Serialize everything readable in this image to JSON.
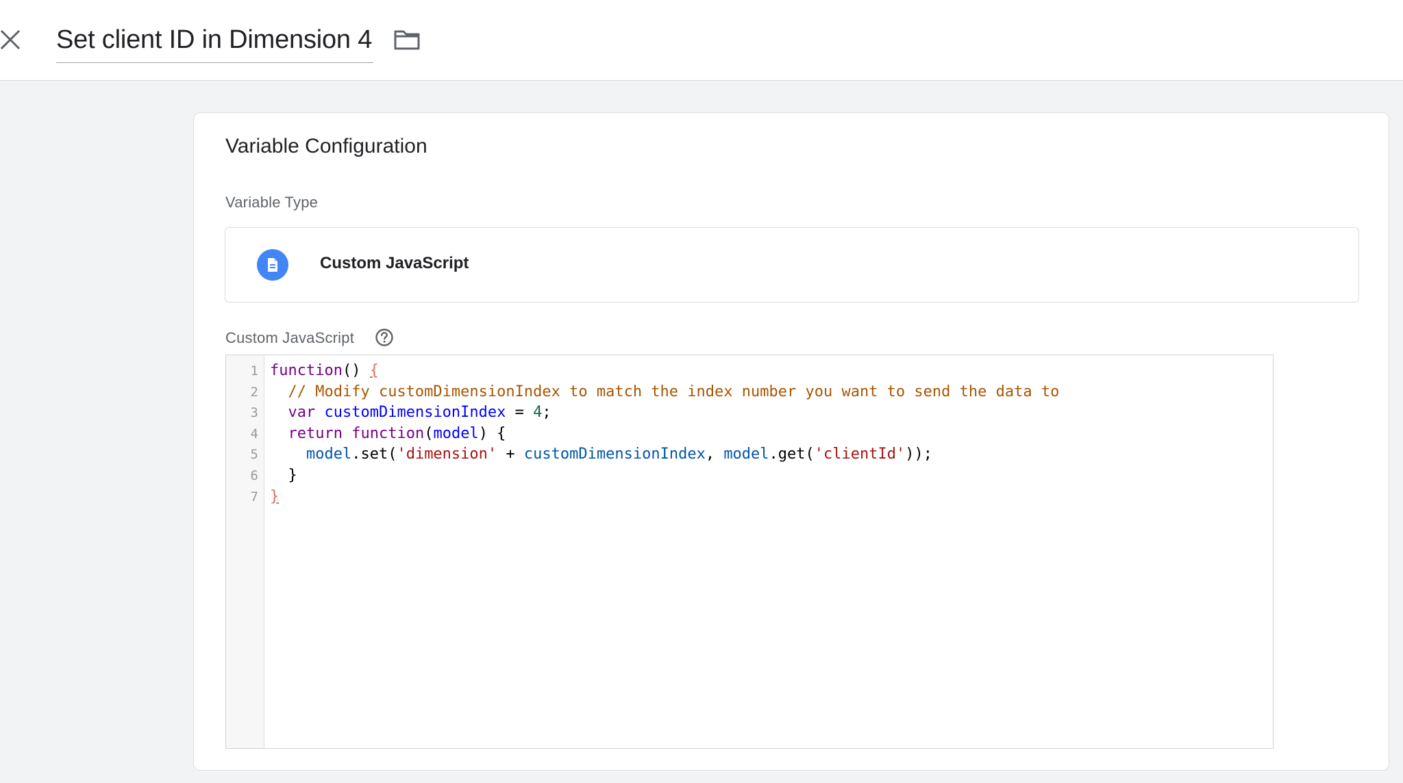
{
  "header": {
    "title": "Set client ID in Dimension 4",
    "close_icon": "close-icon",
    "folder_icon": "folder-icon"
  },
  "config": {
    "title": "Variable Configuration",
    "variable_type_label": "Variable Type",
    "variable_type_value": "Custom JavaScript",
    "variable_type_icon": "document-icon",
    "code_label": "Custom JavaScript",
    "help_icon": "help-circle-icon"
  },
  "editor": {
    "line_numbers": [
      "1",
      "2",
      "3",
      "4",
      "5",
      "6",
      "7"
    ],
    "lines": [
      [
        {
          "text": "function",
          "cls": "tok-keyword"
        },
        {
          "text": "() ",
          "cls": ""
        },
        {
          "text": "{",
          "cls": "tok-bracket-match"
        }
      ],
      [
        {
          "text": "  ",
          "cls": ""
        },
        {
          "text": "// Modify customDimensionIndex to match the index number you want to send the data to",
          "cls": "tok-comment"
        }
      ],
      [
        {
          "text": "  ",
          "cls": ""
        },
        {
          "text": "var",
          "cls": "tok-keyword"
        },
        {
          "text": " ",
          "cls": ""
        },
        {
          "text": "customDimensionIndex",
          "cls": "tok-def"
        },
        {
          "text": " = ",
          "cls": ""
        },
        {
          "text": "4",
          "cls": "tok-number"
        },
        {
          "text": ";",
          "cls": ""
        }
      ],
      [
        {
          "text": "  ",
          "cls": ""
        },
        {
          "text": "return",
          "cls": "tok-keyword"
        },
        {
          "text": " ",
          "cls": ""
        },
        {
          "text": "function",
          "cls": "tok-keyword"
        },
        {
          "text": "(",
          "cls": ""
        },
        {
          "text": "model",
          "cls": "tok-def"
        },
        {
          "text": ") {",
          "cls": ""
        }
      ],
      [
        {
          "text": "    ",
          "cls": ""
        },
        {
          "text": "model",
          "cls": "tok-variable"
        },
        {
          "text": ".set(",
          "cls": ""
        },
        {
          "text": "'dimension'",
          "cls": "tok-string"
        },
        {
          "text": " + ",
          "cls": ""
        },
        {
          "text": "customDimensionIndex",
          "cls": "tok-variable"
        },
        {
          "text": ", ",
          "cls": ""
        },
        {
          "text": "model",
          "cls": "tok-variable"
        },
        {
          "text": ".get(",
          "cls": ""
        },
        {
          "text": "'clientId'",
          "cls": "tok-string"
        },
        {
          "text": "));",
          "cls": ""
        }
      ],
      [
        {
          "text": "  }",
          "cls": ""
        }
      ],
      [
        {
          "text": "}",
          "cls": "tok-bracket-match"
        }
      ]
    ]
  },
  "colors": {
    "accent_blue": "#4285f4",
    "page_background": "#f1f3f4",
    "card_border": "#dadce0"
  }
}
